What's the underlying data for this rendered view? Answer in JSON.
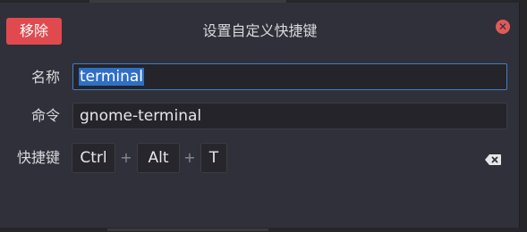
{
  "dialog": {
    "title": "设置自定义快捷键",
    "remove_label": "移除",
    "close_icon": "close-icon",
    "accent_danger": "#e04a4f",
    "accent_selection": "#2f6fc4"
  },
  "form": {
    "name_label": "名称",
    "name_value": "terminal",
    "command_label": "命令",
    "command_value": "gnome-terminal",
    "shortcut_label": "快捷键",
    "keys": [
      "Ctrl",
      "Alt",
      "T"
    ],
    "separator": "+",
    "clear_icon": "backspace-icon"
  }
}
